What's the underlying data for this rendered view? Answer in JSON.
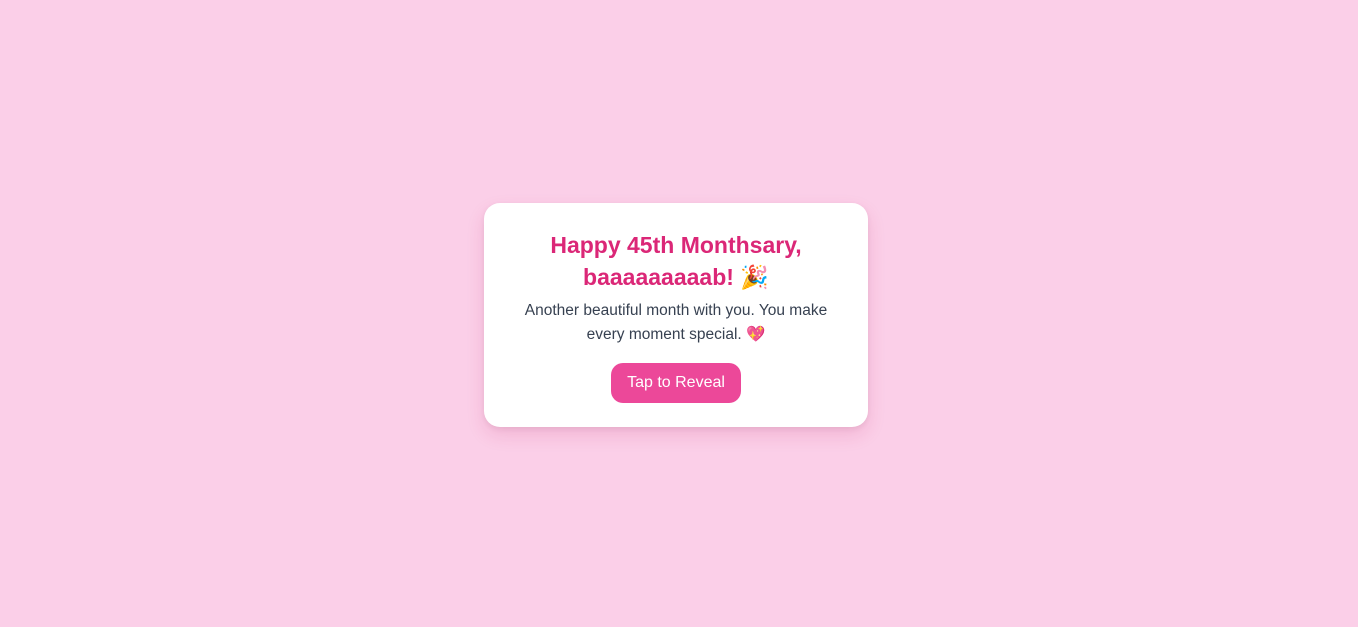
{
  "card": {
    "title_line1": "Happy 45th Monthsary,",
    "title_line2": "baaaaaaaaab!",
    "title_emoji": "🎉",
    "message": "Another beautiful month with you. You make every moment special.",
    "message_emoji": "💖",
    "button_label": "Tap to Reveal"
  },
  "colors": {
    "background": "#fbcfe8",
    "card": "#ffffff",
    "title": "#db2777",
    "text": "#374151",
    "button": "#ec4899",
    "button_text": "#ffffff"
  },
  "icons": {
    "title_emoji": "party-popper-icon",
    "message_emoji": "heart-icon"
  }
}
